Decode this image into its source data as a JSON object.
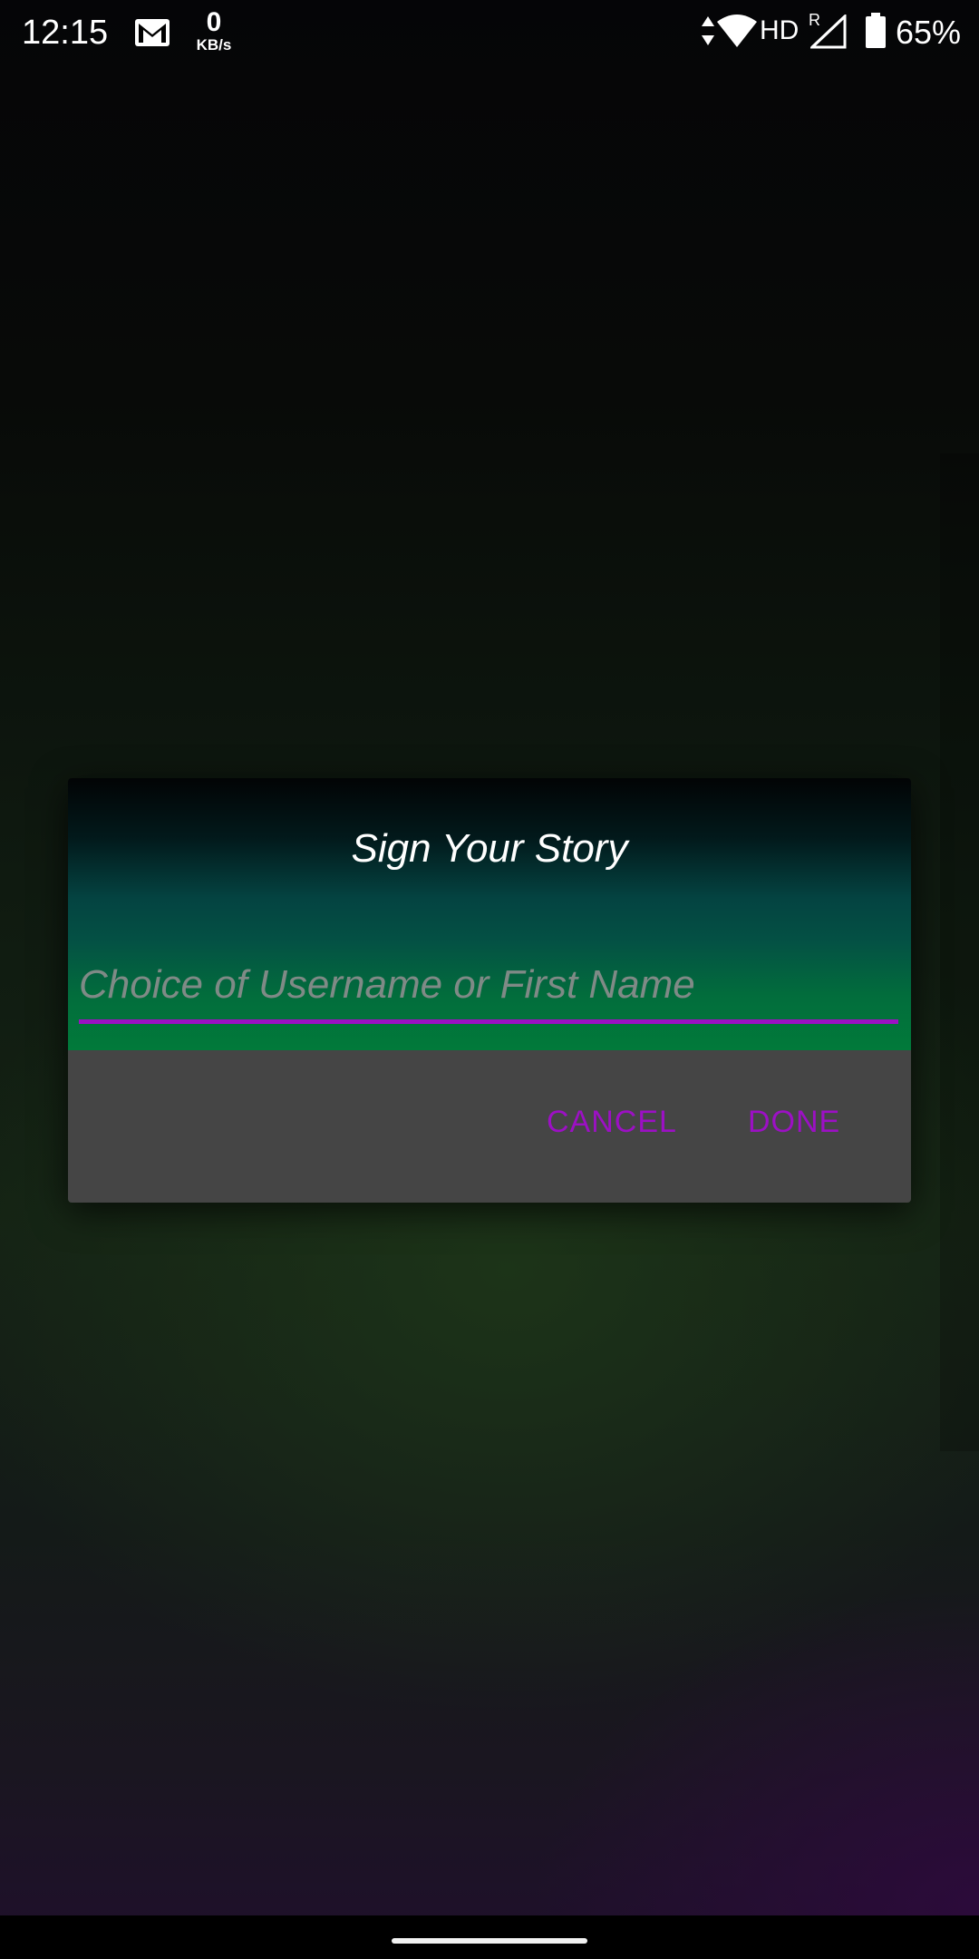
{
  "status_bar": {
    "time": "12:15",
    "net_speed_value": "0",
    "net_speed_unit": "KB/s",
    "network_label": "HD",
    "roaming_indicator": "R",
    "battery_percent": "65%",
    "icons": [
      "gmail-icon",
      "data-arrows-icon",
      "wifi-icon",
      "signal-icon",
      "battery-icon"
    ]
  },
  "dialog": {
    "title": "Sign Your Story",
    "input": {
      "value": "",
      "placeholder": "Choice of Username or First Name"
    },
    "buttons": {
      "cancel_label": "CANCEL",
      "done_label": "DONE"
    }
  },
  "colors": {
    "accent": "#9c10c4",
    "dialog_actions_background": "#454545",
    "dialog_header_gradient_end": "#017a3a"
  }
}
